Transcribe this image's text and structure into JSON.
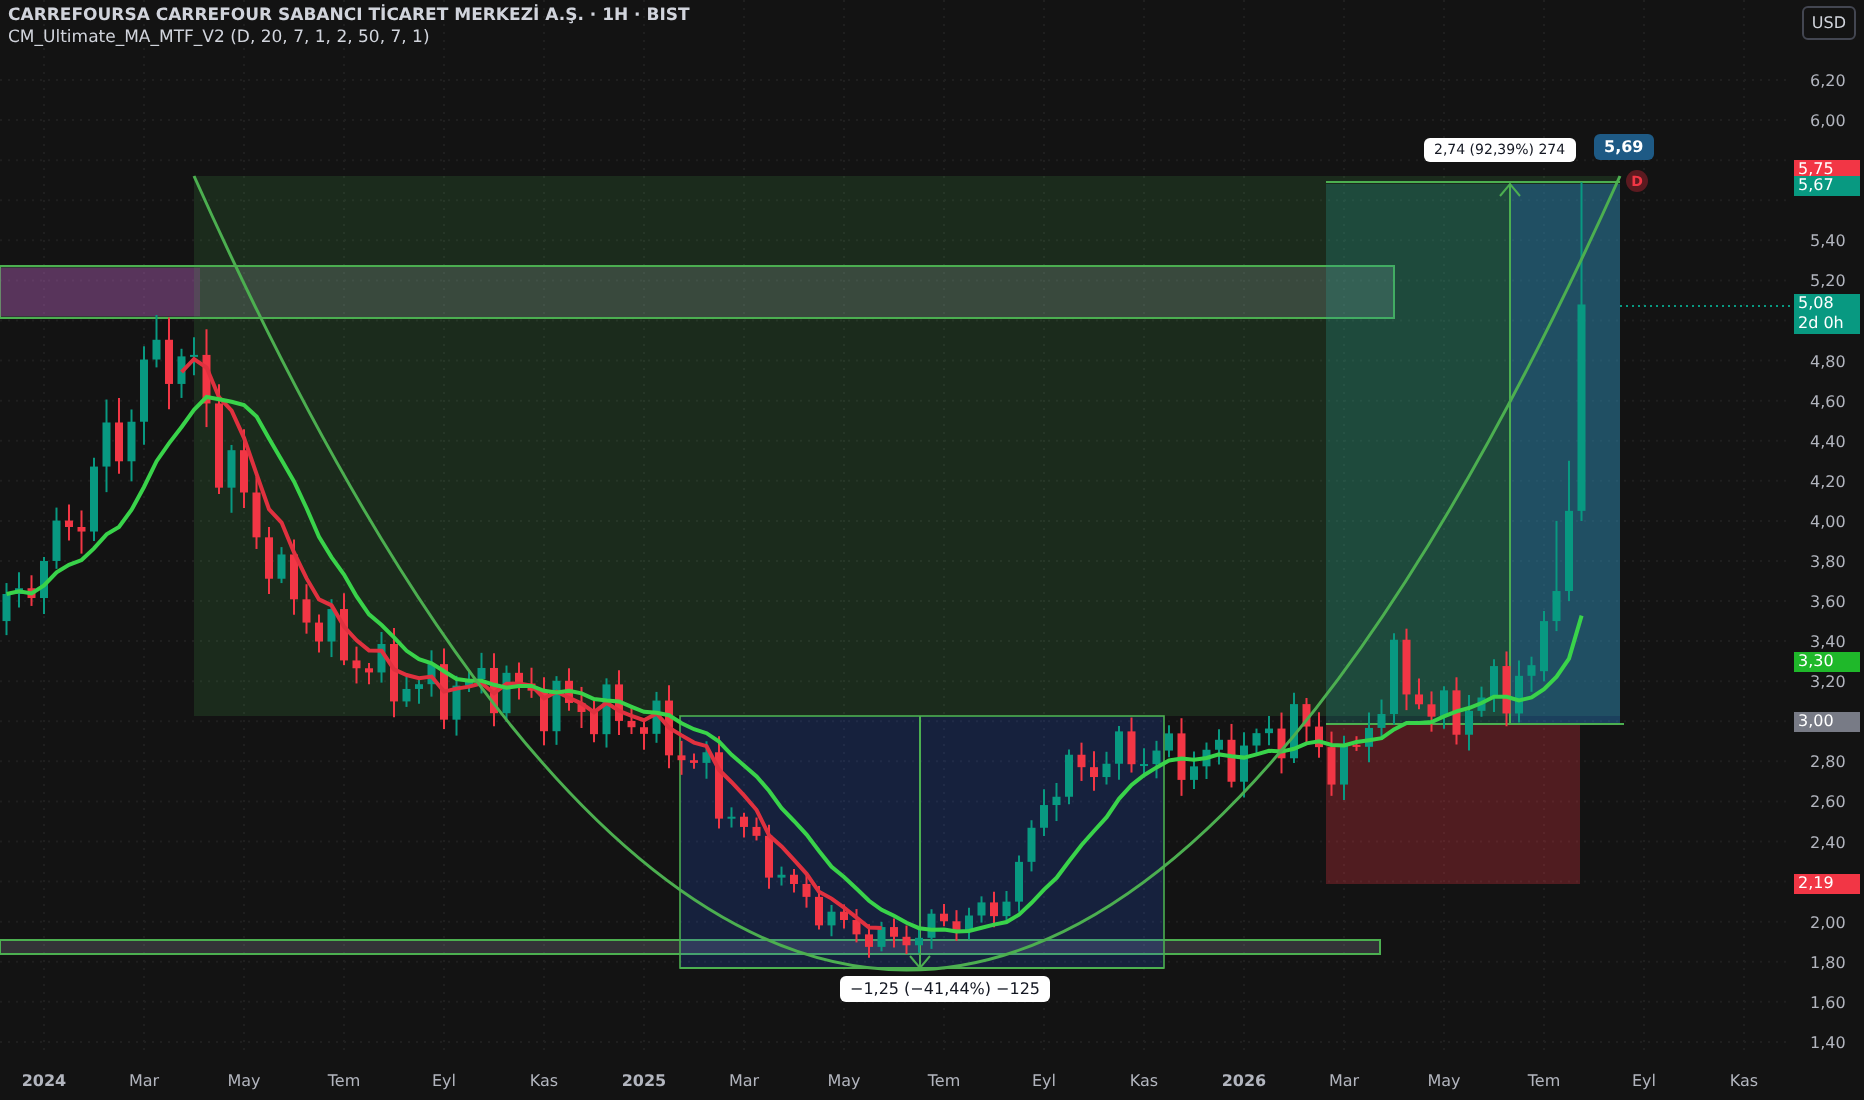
{
  "header": {
    "title": "CARREFOURSA CARREFOUR SABANCI TİCARET MERKEZİ A.Ş. · 1H · BIST",
    "indicator": "CM_Ultimate_MA_MTF_V2 (D, 20, 7, 1, 2, 50, 7, 1)"
  },
  "currency": "USD",
  "price_axis": [
    "6,20",
    "6,00",
    "5,40",
    "5,20",
    "4,80",
    "4,60",
    "4,40",
    "4,20",
    "4,00",
    "3,80",
    "3,60",
    "3,40",
    "3,20",
    "2,80",
    "2,60",
    "2,40",
    "2,00",
    "1,80",
    "1,60",
    "1,40"
  ],
  "price_badges": [
    {
      "text": "5,75",
      "color": "#f23645"
    },
    {
      "text": "5,67",
      "color": "#089981"
    },
    {
      "text": "5,08",
      "sub": "2d 0h",
      "color": "#089981"
    },
    {
      "text": "3,30",
      "color": "#1fb82a"
    },
    {
      "text": "3,00",
      "color": "#787b86"
    },
    {
      "text": "2,19",
      "color": "#f23645"
    }
  ],
  "measurements": [
    {
      "label": "2,74 (92,39%) 274"
    },
    {
      "label": "−1,25 (−41,44%) −125"
    }
  ],
  "target_label": "5,69",
  "dividend_marker": "D",
  "time_axis": [
    "2024",
    "Mar",
    "May",
    "Tem",
    "Eyl",
    "Kas",
    "2025",
    "Mar",
    "May",
    "Tem",
    "Eyl",
    "Kas",
    "2026",
    "Mar",
    "May",
    "Tem",
    "Eyl",
    "Kas"
  ]
}
